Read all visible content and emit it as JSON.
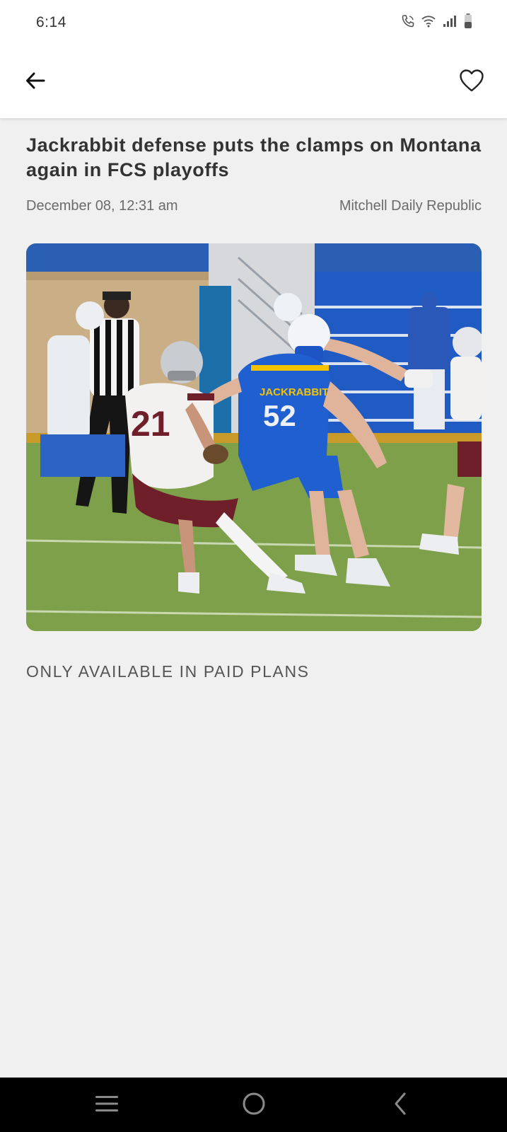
{
  "status_bar": {
    "time": "6:14",
    "icons": [
      "wifi-calling-icon",
      "wifi-icon",
      "signal-icon",
      "battery-icon"
    ]
  },
  "app_bar": {
    "back_icon": "arrow-left-icon",
    "favorite_icon": "heart-outline-icon"
  },
  "article": {
    "title": "Jackrabbit defense puts the clamps on Montana again in FCS playoffs",
    "date": "December 08, 12:31 am",
    "source": "Mitchell Daily Republic",
    "image_jersey_numbers": [
      "21",
      "52"
    ],
    "image_jersey_text": "JACKRABBITS",
    "paywall_notice": "ONLY AVAILABLE IN PAID PLANS"
  },
  "nav_bar": {
    "icons": [
      "recent-apps-icon",
      "home-icon",
      "back-nav-icon"
    ]
  },
  "colors": {
    "background": "#f0f0f0",
    "surface": "#ffffff",
    "text_primary": "#333333",
    "text_secondary": "#6b6b6b",
    "nav_bar": "#000000"
  }
}
